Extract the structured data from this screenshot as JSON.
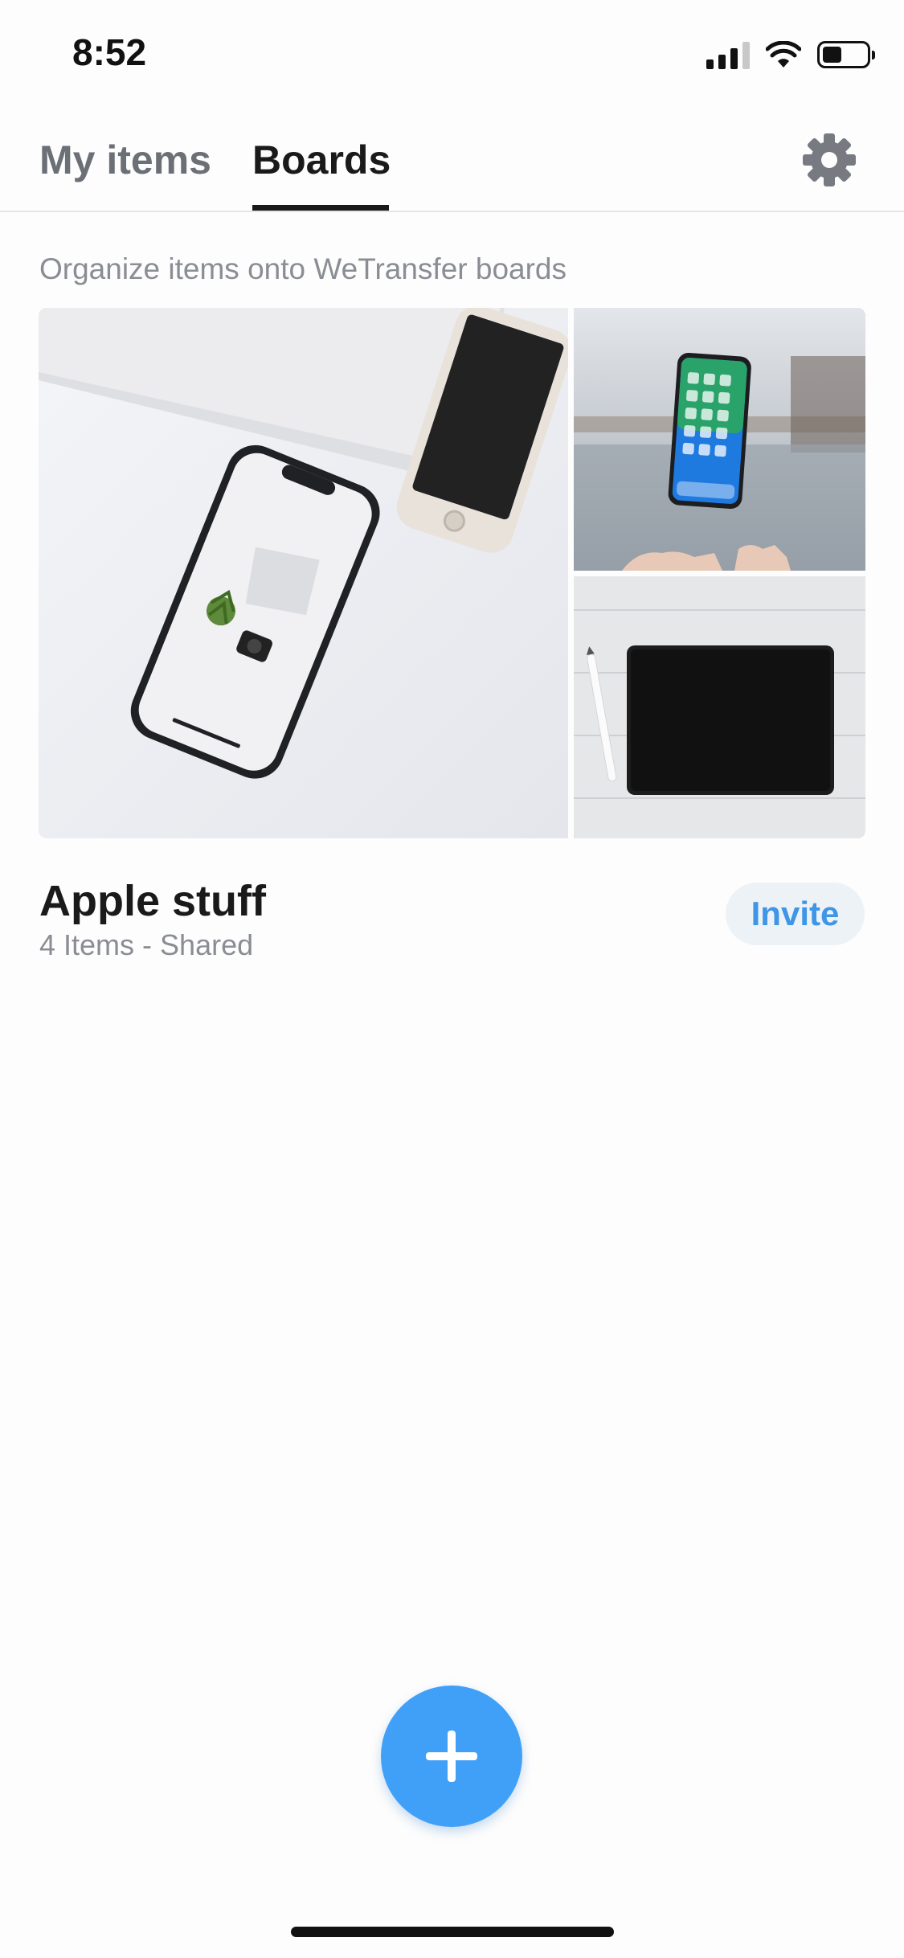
{
  "status_bar": {
    "time": "8:52",
    "battery_level": 0.45
  },
  "tabs": [
    {
      "label": "My items",
      "active": false
    },
    {
      "label": "Boards",
      "active": true
    }
  ],
  "header": {
    "settings_icon": "gear-icon"
  },
  "subtitle": "Organize items onto WeTransfer boards",
  "board": {
    "title": "Apple stuff",
    "meta": "4 Items - Shared",
    "invite_label": "Invite",
    "images": [
      {
        "name": "iphone-on-desk-image",
        "description": "iPhone on white desk with laptop"
      },
      {
        "name": "floating-iphone-image",
        "description": "iPhone floating above hand by lake"
      },
      {
        "name": "ipad-with-pencil-image",
        "description": "iPad and Apple Pencil on white wood"
      }
    ]
  },
  "fab": {
    "icon": "plus-icon"
  },
  "colors": {
    "accent": "#40a0f8",
    "invite_text": "#3f95e6",
    "invite_bg": "#edf2f7"
  }
}
